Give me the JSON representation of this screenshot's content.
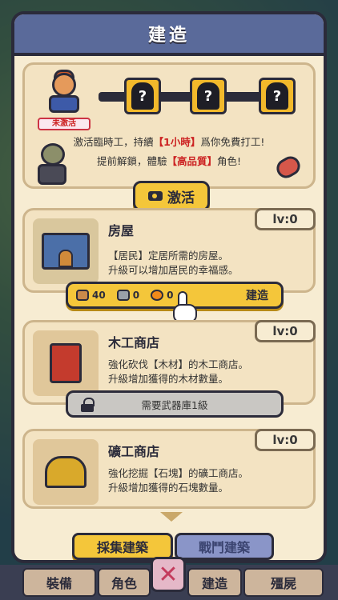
{
  "header": {
    "title": "建造"
  },
  "promo": {
    "hero_badge": "未激活",
    "locked_mark": "?",
    "line1_prefix": "激活臨時工，持續",
    "line1_highlight": "【1小時】",
    "line1_suffix": "爲你免費打工!",
    "line2_prefix": "提前解鎖，體驗",
    "line2_highlight": "【高品質】",
    "line2_suffix": "角色!",
    "activate_label": "激活"
  },
  "buildings": [
    {
      "name": "房屋",
      "level": "lv:0",
      "desc1": "【居民】定居所需的房屋。",
      "desc2": "升級可以增加居民的幸福感。",
      "cost_wood": "40",
      "cost_stone": "0",
      "cost_energy": "0",
      "build_label": "建造"
    },
    {
      "name": "木工商店",
      "level": "lv:0",
      "desc1": "強化砍伐【木材】的木工商店。",
      "desc2": "升級增加獲得的木材數量。",
      "locked_label": "需要武器庫1級"
    },
    {
      "name": "礦工商店",
      "level": "lv:0",
      "desc1": "強化挖掘【石塊】的礦工商店。",
      "desc2": "升級增加獲得的石塊數量。"
    }
  ],
  "tabs": {
    "gather": "採集建築",
    "battle": "戰鬥建築"
  },
  "bottom_nav": [
    "裝備",
    "角色",
    "建造",
    "殭屍"
  ],
  "close_symbol": "✕",
  "colors": {
    "accent": "#f4c63a",
    "header": "#5a6a9a",
    "highlight": "#cc2222"
  }
}
